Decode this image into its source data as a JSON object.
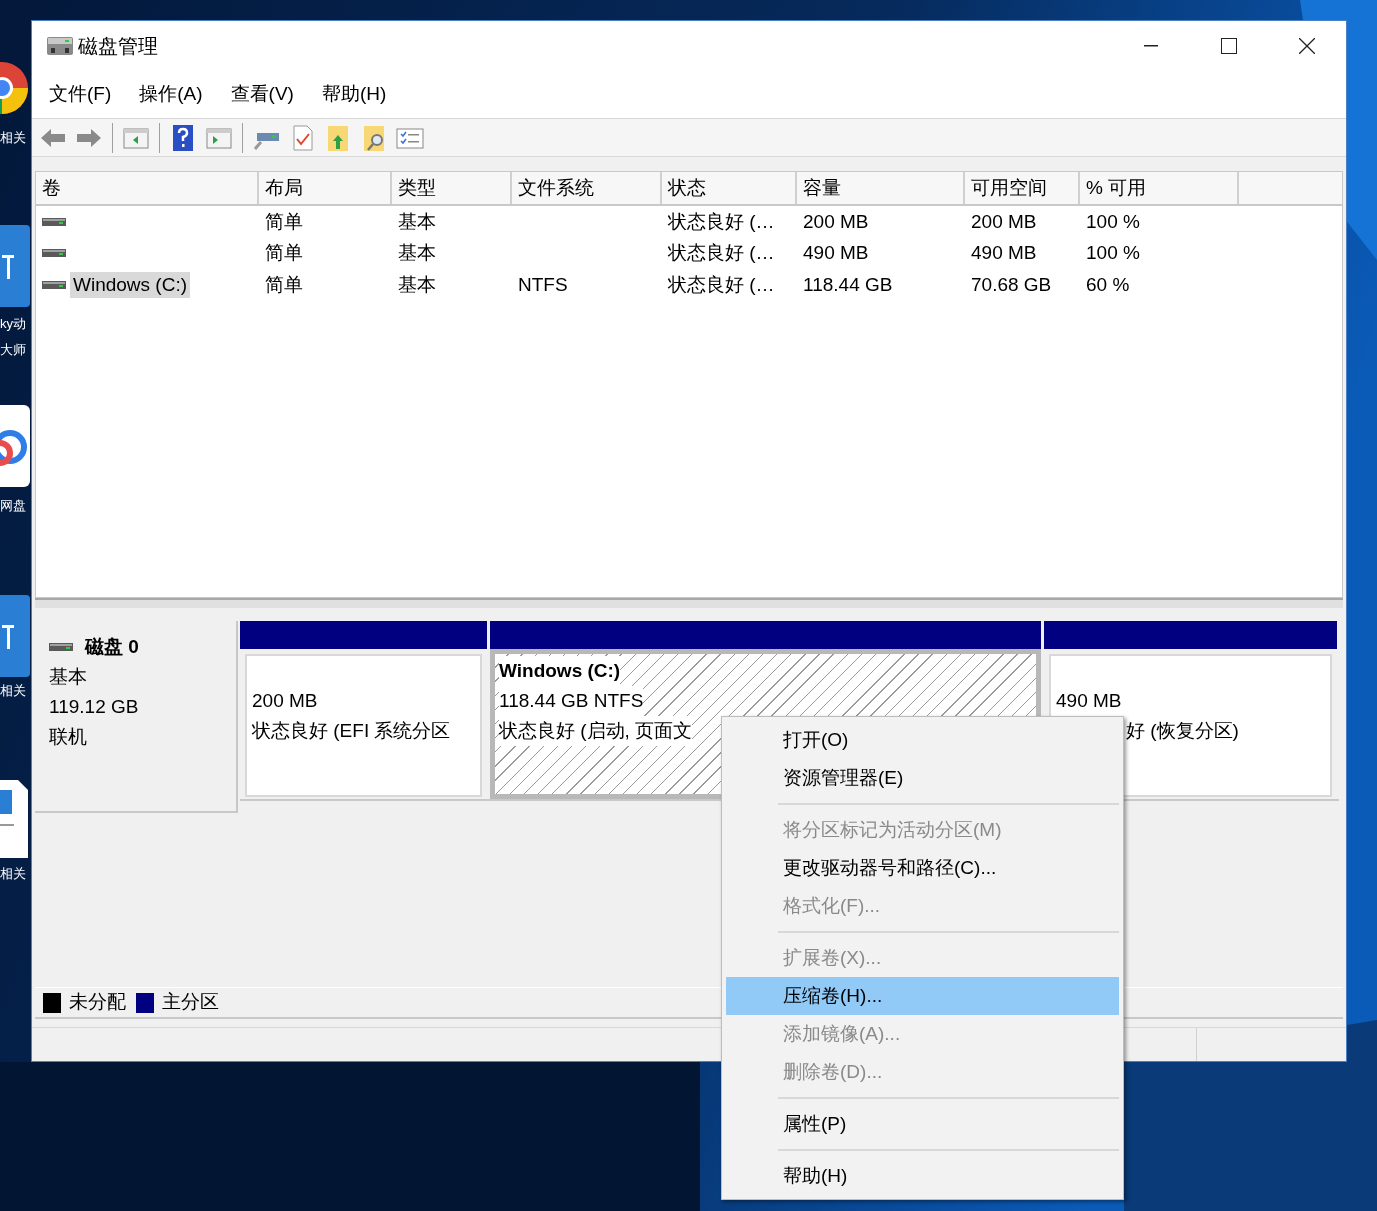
{
  "desktop_icons": [
    {
      "kind": "chrome",
      "labels": [
        "相关"
      ]
    },
    {
      "kind": "tile",
      "labels": [
        "ky动",
        "大师"
      ]
    },
    {
      "kind": "cloud",
      "labels": [
        "网盘"
      ]
    },
    {
      "kind": "tile",
      "labels": [
        "相关"
      ]
    },
    {
      "kind": "doc",
      "labels": [
        "相关"
      ]
    }
  ],
  "window": {
    "title": "磁盘管理"
  },
  "menu": [
    "文件(F)",
    "操作(A)",
    "查看(V)",
    "帮助(H)"
  ],
  "table": {
    "columns": [
      "卷",
      "布局",
      "类型",
      "文件系统",
      "状态",
      "容量",
      "可用空间",
      "% 可用"
    ],
    "rows": [
      {
        "layout": "简单",
        "type": "基本",
        "status": "状态良好 (…",
        "capacity": "200 MB",
        "free": "200 MB",
        "percent": "100 %",
        "selected": false
      },
      {
        "layout": "简单",
        "type": "基本",
        "status": "状态良好 (…",
        "capacity": "490 MB",
        "free": "490 MB",
        "percent": "100 %",
        "selected": false
      },
      {
        "volume": "Windows (C:)",
        "layout": "简单",
        "type": "基本",
        "file_system": "NTFS",
        "status": "状态良好 (…",
        "capacity": "118.44 GB",
        "free": "70.68 GB",
        "percent": "60 %",
        "selected": true
      }
    ]
  },
  "disk": {
    "name": "磁盘 0",
    "type": "基本",
    "size": "119.12 GB",
    "status": "联机",
    "partitions": [
      {
        "kind": "plain",
        "selected": false,
        "lines": [
          "200 MB",
          "状态良好 (EFI 系统分区"
        ]
      },
      {
        "kind": "hatched",
        "selected": true,
        "title": "Windows  (C:)",
        "lines": [
          "118.44 GB NTFS",
          "状态良好 (启动, 页面文"
        ]
      },
      {
        "kind": "plain",
        "selected": false,
        "covered": true,
        "lines": [
          "490 MB",
          "好 (恢复分区)"
        ]
      }
    ]
  },
  "legend": [
    {
      "label": "未分配",
      "color": "#000000"
    },
    {
      "label": "主分区",
      "color": "#000080"
    }
  ],
  "context_menu": [
    {
      "kind": "item",
      "label": "打开(O)",
      "disabled": false,
      "selected": false
    },
    {
      "kind": "item",
      "label": "资源管理器(E)",
      "disabled": false,
      "selected": false
    },
    {
      "kind": "separator"
    },
    {
      "kind": "item",
      "label": "将分区标记为活动分区(M)",
      "disabled": true,
      "selected": false
    },
    {
      "kind": "item",
      "label": "更改驱动器号和路径(C)...",
      "disabled": false,
      "selected": false
    },
    {
      "kind": "item",
      "label": "格式化(F)...",
      "disabled": true,
      "selected": false
    },
    {
      "kind": "separator"
    },
    {
      "kind": "item",
      "label": "扩展卷(X)...",
      "disabled": true,
      "selected": false
    },
    {
      "kind": "item",
      "label": "压缩卷(H)...",
      "disabled": false,
      "selected": true
    },
    {
      "kind": "item",
      "label": "添加镜像(A)...",
      "disabled": true,
      "selected": false
    },
    {
      "kind": "item",
      "label": "删除卷(D)...",
      "disabled": true,
      "selected": false
    },
    {
      "kind": "separator"
    },
    {
      "kind": "item",
      "label": "属性(P)",
      "disabled": false,
      "selected": false
    },
    {
      "kind": "separator"
    },
    {
      "kind": "item",
      "label": "帮助(H)",
      "disabled": false,
      "selected": false
    }
  ]
}
